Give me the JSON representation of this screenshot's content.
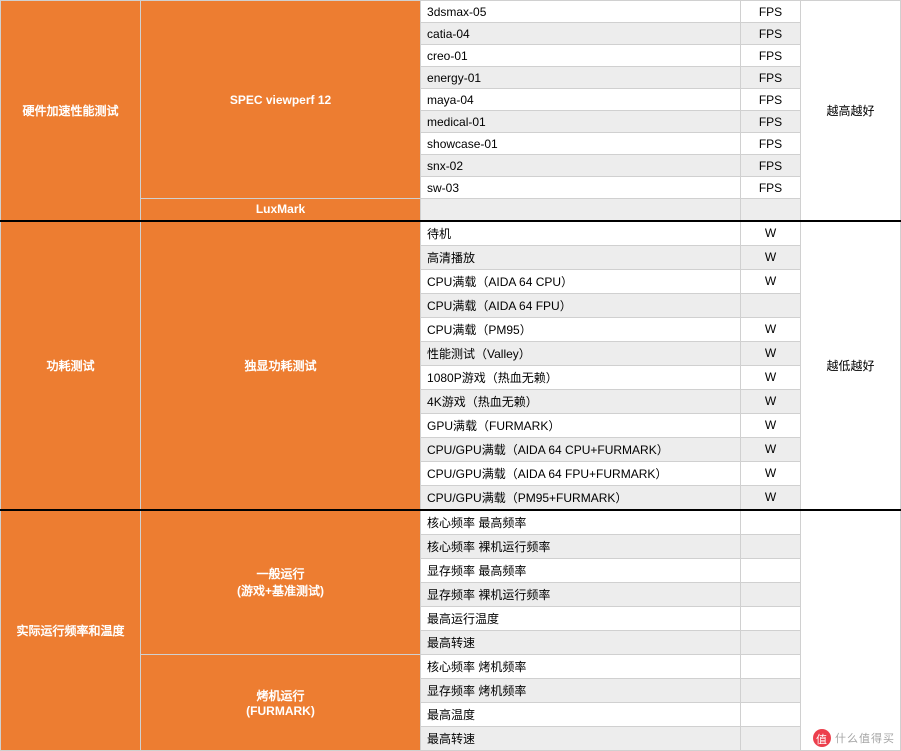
{
  "sections": {
    "hw_accel": {
      "label": "硬件加速性能测试",
      "tests": {
        "spec": {
          "label": "SPEC viewperf 12",
          "rows": [
            {
              "name": "3dsmax-05",
              "unit": "FPS",
              "shade": "white"
            },
            {
              "name": "catia-04",
              "unit": "FPS",
              "shade": "grey"
            },
            {
              "name": "creo-01",
              "unit": "FPS",
              "shade": "white"
            },
            {
              "name": "energy-01",
              "unit": "FPS",
              "shade": "grey"
            },
            {
              "name": "maya-04",
              "unit": "FPS",
              "shade": "white"
            },
            {
              "name": "medical-01",
              "unit": "FPS",
              "shade": "grey"
            },
            {
              "name": "showcase-01",
              "unit": "FPS",
              "shade": "white"
            },
            {
              "name": "snx-02",
              "unit": "FPS",
              "shade": "grey"
            },
            {
              "name": "sw-03",
              "unit": "FPS",
              "shade": "white"
            }
          ]
        },
        "luxmark": {
          "label": "LuxMark"
        }
      },
      "note": "越高越好"
    },
    "power": {
      "label": "功耗测试",
      "subtest": "独显功耗测试",
      "rows": [
        {
          "name": "待机",
          "unit": "W",
          "shade": "white"
        },
        {
          "name": "高清播放",
          "unit": "W",
          "shade": "grey"
        },
        {
          "name": "CPU满载（AIDA 64 CPU）",
          "unit": "W",
          "shade": "white"
        },
        {
          "name": "CPU满载（AIDA 64 FPU）",
          "unit": "",
          "shade": "grey"
        },
        {
          "name": "CPU满载（PM95）",
          "unit": "W",
          "shade": "white"
        },
        {
          "name": "性能测试（Valley）",
          "unit": "W",
          "shade": "grey"
        },
        {
          "name": "1080P游戏（热血无赖）",
          "unit": "W",
          "shade": "white"
        },
        {
          "name": "4K游戏（热血无赖）",
          "unit": "W",
          "shade": "grey"
        },
        {
          "name": "GPU满载（FURMARK）",
          "unit": "W",
          "shade": "white"
        },
        {
          "name": "CPU/GPU满载（AIDA 64 CPU+FURMARK）",
          "unit": "W",
          "shade": "grey"
        },
        {
          "name": "CPU/GPU满载（AIDA 64 FPU+FURMARK）",
          "unit": "W",
          "shade": "white"
        },
        {
          "name": "CPU/GPU满载（PM95+FURMARK）",
          "unit": "W",
          "shade": "grey"
        }
      ],
      "note": "越低越好"
    },
    "freq_temp": {
      "label": "实际运行频率和温度",
      "normal": {
        "label_l1": "一般运行",
        "label_l2": "(游戏+基准测试)",
        "rows": [
          {
            "name": "核心频率 最高频率",
            "shade": "white"
          },
          {
            "name": "核心频率 裸机运行频率",
            "shade": "grey"
          },
          {
            "name": "显存频率 最高频率",
            "shade": "white"
          },
          {
            "name": "显存频率 裸机运行频率",
            "shade": "grey"
          },
          {
            "name": "最高运行温度",
            "shade": "white"
          },
          {
            "name": "最高转速",
            "shade": "grey"
          }
        ]
      },
      "stress": {
        "label_l1": "烤机运行",
        "label_l2": "(FURMARK)",
        "rows": [
          {
            "name": "核心频率 烤机频率",
            "shade": "white"
          },
          {
            "name": "显存频率 烤机频率",
            "shade": "grey"
          },
          {
            "name": "最高温度",
            "shade": "white"
          },
          {
            "name": "最高转速",
            "shade": "grey"
          }
        ]
      }
    }
  },
  "watermark": "什么值得买"
}
